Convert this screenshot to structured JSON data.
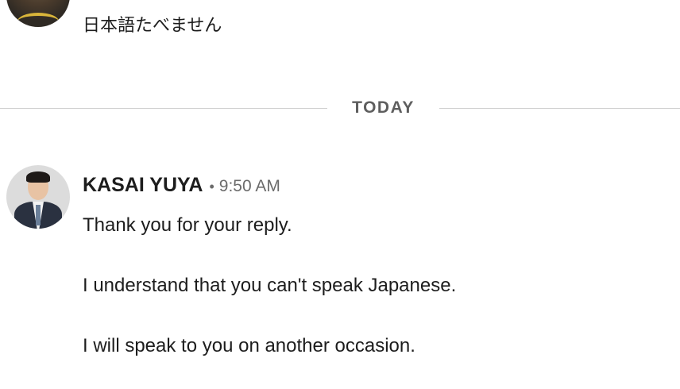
{
  "previous_message": {
    "text": "日本語たべません"
  },
  "divider": {
    "label": "TODAY"
  },
  "message": {
    "sender": "KASAI YUYA",
    "separator": "•",
    "time": "9:50 AM",
    "paragraphs": [
      "Thank you for your reply.",
      "I understand that you can't speak Japanese.",
      "I will speak to you on another occasion."
    ]
  }
}
